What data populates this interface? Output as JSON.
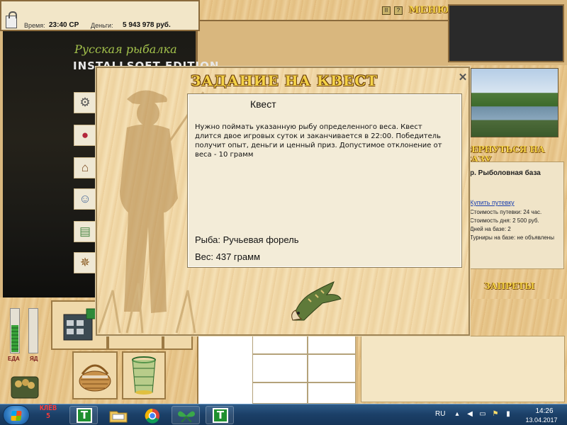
{
  "status_bar": {
    "time_label": "Время:",
    "time_value": "23:40 СР",
    "money_label": "Деньги:",
    "money_value": "5 943 978 руб."
  },
  "top_menu": {
    "help_glyph": "?",
    "pause_glyph": "II",
    "menu_label": "МЕНЮ"
  },
  "game": {
    "title": "Русская рыбалка",
    "edition": "INSTALLSOFT EDITION"
  },
  "nav_icons": [
    {
      "name": "reel",
      "glyph": "⚙"
    },
    {
      "name": "bait",
      "glyph": "●"
    },
    {
      "name": "base",
      "glyph": "⌂"
    },
    {
      "name": "people",
      "glyph": "☺"
    },
    {
      "name": "money",
      "glyph": "▤"
    },
    {
      "name": "wheel",
      "glyph": "✵"
    }
  ],
  "right_panel": {
    "return_label": "ВЕРНУТЬСЯ НА БАЗУ",
    "base_title": "р. Рыболовная база",
    "buy_link": "Купить путевку",
    "lines": [
      "Стоимость путевки: 24 час.",
      "Стоимость дня: 2 500 руб.",
      "Дней на базе: 2",
      "Турниры на базе: не объявлены"
    ],
    "restrictions_label": "ЗАПРЕТЫ"
  },
  "meters": {
    "food_label": "ЕДА",
    "food_level": 0.62,
    "second_label": "ЯД",
    "second_level": 0.0
  },
  "modal": {
    "title": "ЗАДАНИЕ НА КВЕСТ",
    "close_glyph": "✕",
    "heading": "Квест",
    "description": "Нужно поймать указанную рыбу определенного веса. Квест длится двое игровых суток и заканчивается в 22:00. Победитель получит опыт, деньги и ценный приз. Допустимое отклонение от веса - 10 грамм",
    "fish": "Рыба: Ручьевая форель",
    "weight": "Вес: 437 грамм"
  },
  "taskbar": {
    "klev_text": "КЛЁВ\n5",
    "app_t_glyph": "T",
    "language": "RU",
    "time": "14:26",
    "date": "13.04.2017"
  },
  "colors": {
    "gold_text": "#f4d247",
    "wood": "#e3bf82",
    "taskbar": "#1b3f67"
  }
}
